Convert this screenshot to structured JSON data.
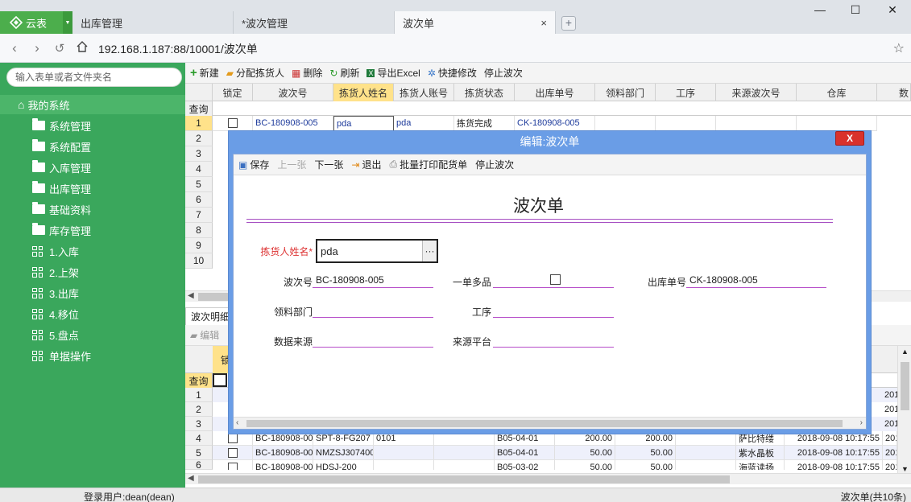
{
  "browser": {
    "app_name": "云表",
    "tabs": [
      {
        "label": "出库管理"
      },
      {
        "label": "*波次管理"
      },
      {
        "label": "波次单",
        "close": "×"
      }
    ],
    "new_tab": "+",
    "window": {
      "minimize": "—",
      "maximize": "☐",
      "close": "✕"
    },
    "url": "192.168.1.187:88/10001/波次单"
  },
  "sidebar": {
    "search_placeholder": "输入表单或者文件夹名",
    "root": "我的系统",
    "items": [
      {
        "label": "系统管理",
        "icon": "folder-icon"
      },
      {
        "label": "系统配置",
        "icon": "folder-icon"
      },
      {
        "label": "入库管理",
        "icon": "folder-icon"
      },
      {
        "label": "出库管理",
        "icon": "folder-icon"
      },
      {
        "label": "基础资料",
        "icon": "folder-icon"
      },
      {
        "label": "库存管理",
        "icon": "folder-icon"
      },
      {
        "label": "1.入库",
        "icon": "grid-icon"
      },
      {
        "label": "2.上架",
        "icon": "grid-icon"
      },
      {
        "label": "3.出库",
        "icon": "grid-icon"
      },
      {
        "label": "4.移位",
        "icon": "grid-icon"
      },
      {
        "label": "5.盘点",
        "icon": "grid-icon"
      },
      {
        "label": "单据操作",
        "icon": "grid-icon"
      }
    ]
  },
  "toolbar": {
    "new": "新建",
    "assign": "分配拣货人",
    "delete": "删除",
    "refresh": "刷新",
    "export": "导出Excel",
    "quick_edit": "快捷修改",
    "stop_wave": "停止波次"
  },
  "grid": {
    "columns": [
      "锁定",
      "波次号",
      "拣货人姓名",
      "拣货人账号",
      "拣货状态",
      "出库单号",
      "领料部门",
      "工序",
      "来源波次号",
      "仓库",
      "数"
    ],
    "query_label": "查询",
    "row_numbers": [
      "1",
      "2",
      "3",
      "4",
      "5",
      "6",
      "7",
      "8",
      "9",
      "10"
    ],
    "row1": {
      "wave_no": "BC-180908-005",
      "picker_name": "pda",
      "picker_account": "pda",
      "status": "拣货完成",
      "outbound_no": "CK-180908-005"
    }
  },
  "detail": {
    "tab_label": "波次明细",
    "edit_label": "编辑",
    "head_partial": "锁",
    "query_label": "查询",
    "row_numbers": [
      "1",
      "2",
      "3",
      "4",
      "5",
      "6"
    ],
    "rows": [
      {
        "wave": "BC-180908-00",
        "sku": "SPT-8-FG207",
        "code": "0101",
        "loc": "B05-04-01",
        "q1": "200.00",
        "q2": "200.00",
        "name": "萨比特缕",
        "time": "2018-09-08 10:17:55",
        "tail": "201"
      },
      {
        "wave": "BC-180908-00",
        "sku": "NMZSJ307400:",
        "code": "",
        "loc": "B05-04-01",
        "q1": "50.00",
        "q2": "50.00",
        "name": "紫水晶板",
        "time": "2018-09-08 10:17:55",
        "tail": "201"
      },
      {
        "wave": "BC-180908-00",
        "sku": "HDSJ-200",
        "code": "",
        "loc": "B05-03-02",
        "q1": "50.00",
        "q2": "50.00",
        "name": "海蓝读扬",
        "time": "2018-09-08 10:17:55",
        "tail": "201"
      }
    ],
    "tail_values": [
      "201",
      "201",
      "201"
    ]
  },
  "status": {
    "user": "登录用户:dean(dean)",
    "count": "波次单(共10条)"
  },
  "dialog": {
    "title": "编辑:波次单",
    "close": "X",
    "toolbar": {
      "save": "保存",
      "prev": "上一张",
      "next": "下一张",
      "exit": "退出",
      "print": "批量打印配货单",
      "stop": "停止波次"
    },
    "doc_title": "波次单",
    "fields": {
      "picker_name_label": "拣货人姓名*",
      "picker_name_value": "pda",
      "picker_button": "···",
      "wave_no_label": "波次号",
      "wave_no_value": "BC-180908-005",
      "multi_label": "一单多品",
      "outbound_label": "出库单号",
      "outbound_value": "CK-180908-005",
      "dept_label": "领料部门",
      "process_label": "工序",
      "source_label": "数据来源",
      "platform_label": "来源平台"
    }
  }
}
